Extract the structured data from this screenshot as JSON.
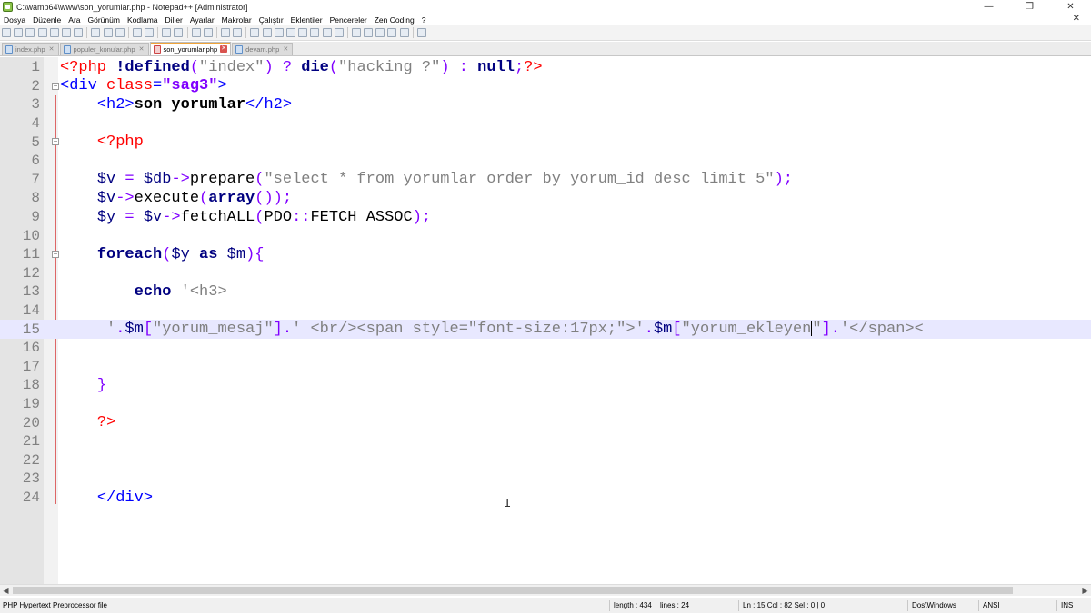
{
  "window": {
    "title": "C:\\wamp64\\www\\son_yorumlar.php - Notepad++ [Administrator]",
    "minimize_glyph": "—",
    "restore_glyph": "❐",
    "close_glyph": "✕"
  },
  "menu": {
    "items": [
      "Dosya",
      "Düzenle",
      "Ara",
      "Görünüm",
      "Kodlama",
      "Diller",
      "Ayarlar",
      "Makrolar",
      "Çalıştır",
      "Eklentiler",
      "Pencereler",
      "Zen Coding",
      "?"
    ],
    "close_glyph": "✕"
  },
  "tabs": [
    {
      "label": "index.php",
      "active": false
    },
    {
      "label": "populer_konular.php",
      "active": false
    },
    {
      "label": "son_yorumlar.php",
      "active": true
    },
    {
      "label": "devam.php",
      "active": false
    }
  ],
  "editor": {
    "current_line": 15,
    "lines": [
      {
        "n": "1",
        "fold": "",
        "tokens": [
          [
            "c-tag",
            "<?php "
          ],
          [
            "c-kw",
            "!defined"
          ],
          [
            "c-op",
            "("
          ],
          [
            "c-str",
            "\"index\""
          ],
          [
            "c-op",
            ") ? "
          ],
          [
            "c-kw",
            "die"
          ],
          [
            "c-op",
            "("
          ],
          [
            "c-str",
            "\"hacking ?\""
          ],
          [
            "c-op",
            ") : "
          ],
          [
            "c-kw",
            "null"
          ],
          [
            "c-op",
            ";"
          ],
          [
            "c-tag",
            "?>"
          ]
        ]
      },
      {
        "n": "2",
        "fold": "minus",
        "tokens": [
          [
            "c-html",
            "<div "
          ],
          [
            "c-attr",
            "class"
          ],
          [
            "c-html",
            "="
          ],
          [
            "c-attrval",
            "\"sag3\""
          ],
          [
            "c-html",
            ">"
          ]
        ]
      },
      {
        "n": "3",
        "fold": "",
        "tokens": [
          [
            "c-plain",
            "    "
          ],
          [
            "c-html",
            "<h2>"
          ],
          [
            "c-bold",
            "son yorumlar"
          ],
          [
            "c-html",
            "</h2>"
          ]
        ]
      },
      {
        "n": "4",
        "fold": "",
        "tokens": []
      },
      {
        "n": "5",
        "fold": "minus",
        "tokens": [
          [
            "c-plain",
            "    "
          ],
          [
            "c-tag",
            "<?php"
          ]
        ]
      },
      {
        "n": "6",
        "fold": "",
        "tokens": []
      },
      {
        "n": "7",
        "fold": "",
        "tokens": [
          [
            "c-plain",
            "    "
          ],
          [
            "c-var",
            "$v"
          ],
          [
            "c-op",
            " = "
          ],
          [
            "c-var",
            "$db"
          ],
          [
            "c-op",
            "->"
          ],
          [
            "c-plain",
            "prepare"
          ],
          [
            "c-op",
            "("
          ],
          [
            "c-str",
            "\"select * from yorumlar order by yorum_id desc limit 5\""
          ],
          [
            "c-op",
            ");"
          ]
        ]
      },
      {
        "n": "8",
        "fold": "",
        "tokens": [
          [
            "c-plain",
            "    "
          ],
          [
            "c-var",
            "$v"
          ],
          [
            "c-op",
            "->"
          ],
          [
            "c-plain",
            "execute"
          ],
          [
            "c-op",
            "("
          ],
          [
            "c-kw",
            "array"
          ],
          [
            "c-op",
            "());"
          ]
        ]
      },
      {
        "n": "9",
        "fold": "",
        "tokens": [
          [
            "c-plain",
            "    "
          ],
          [
            "c-var",
            "$y"
          ],
          [
            "c-op",
            " = "
          ],
          [
            "c-var",
            "$v"
          ],
          [
            "c-op",
            "->"
          ],
          [
            "c-plain",
            "fetchALL"
          ],
          [
            "c-op",
            "("
          ],
          [
            "c-plain",
            "PDO"
          ],
          [
            "c-op",
            "::"
          ],
          [
            "c-plain",
            "FETCH_ASSOC"
          ],
          [
            "c-op",
            ");"
          ]
        ]
      },
      {
        "n": "10",
        "fold": "",
        "tokens": []
      },
      {
        "n": "11",
        "fold": "minus",
        "tokens": [
          [
            "c-plain",
            "    "
          ],
          [
            "c-kw",
            "foreach"
          ],
          [
            "c-op",
            "("
          ],
          [
            "c-var",
            "$y "
          ],
          [
            "c-kw",
            "as "
          ],
          [
            "c-var",
            "$m"
          ],
          [
            "c-op",
            "){"
          ]
        ]
      },
      {
        "n": "12",
        "fold": "",
        "tokens": []
      },
      {
        "n": "13",
        "fold": "",
        "tokens": [
          [
            "c-plain",
            "        "
          ],
          [
            "c-kw",
            "echo "
          ],
          [
            "c-str",
            "'<h3>"
          ]
        ]
      },
      {
        "n": "14",
        "fold": "",
        "tokens": []
      },
      {
        "n": "15",
        "fold": "",
        "tokens": [
          [
            "c-plain",
            "     "
          ],
          [
            "c-str",
            "'"
          ],
          [
            "c-op",
            "."
          ],
          [
            "c-var",
            "$m"
          ],
          [
            "c-op",
            "["
          ],
          [
            "c-str",
            "\"yorum_mesaj\""
          ],
          [
            "c-op",
            "]."
          ],
          [
            "c-str",
            "' <br/><span style=\"font-size:17px;\">'"
          ],
          [
            "c-op",
            "."
          ],
          [
            "c-var",
            "$m"
          ],
          [
            "c-op",
            "["
          ],
          [
            "c-str",
            "\"yorum_ekleyen"
          ],
          [
            "caret",
            ""
          ],
          [
            "c-str",
            "\""
          ],
          [
            "c-op",
            "]."
          ],
          [
            "c-str",
            "'</span><"
          ]
        ]
      },
      {
        "n": "16",
        "fold": "",
        "tokens": []
      },
      {
        "n": "17",
        "fold": "",
        "tokens": []
      },
      {
        "n": "18",
        "fold": "",
        "tokens": [
          [
            "c-plain",
            "    "
          ],
          [
            "c-op",
            "}"
          ]
        ]
      },
      {
        "n": "19",
        "fold": "",
        "tokens": []
      },
      {
        "n": "20",
        "fold": "",
        "tokens": [
          [
            "c-plain",
            "    "
          ],
          [
            "c-tag",
            "?>"
          ]
        ]
      },
      {
        "n": "21",
        "fold": "",
        "tokens": []
      },
      {
        "n": "22",
        "fold": "",
        "tokens": []
      },
      {
        "n": "23",
        "fold": "",
        "tokens": []
      },
      {
        "n": "24",
        "fold": "",
        "tokens": [
          [
            "c-plain",
            "    "
          ],
          [
            "c-html",
            "</div>"
          ]
        ]
      }
    ],
    "mouse_cursor": "I"
  },
  "scrollbar": {
    "left_arrow": "◀",
    "right_arrow": "▶"
  },
  "status": {
    "file_type": "PHP Hypertext Preprocessor file",
    "length": "length : 434",
    "lines": "lines : 24",
    "position": "Ln : 15    Col : 82    Sel : 0 | 0",
    "eol": "Dos\\Windows",
    "encoding": "ANSI",
    "mode": "INS"
  },
  "colors": {
    "tag": "#ff0000",
    "keyword": "#000080",
    "string": "#808080",
    "html": "#0000ff",
    "current_line": "#e8e8ff",
    "active_tab_accent": "#f0a53b"
  }
}
